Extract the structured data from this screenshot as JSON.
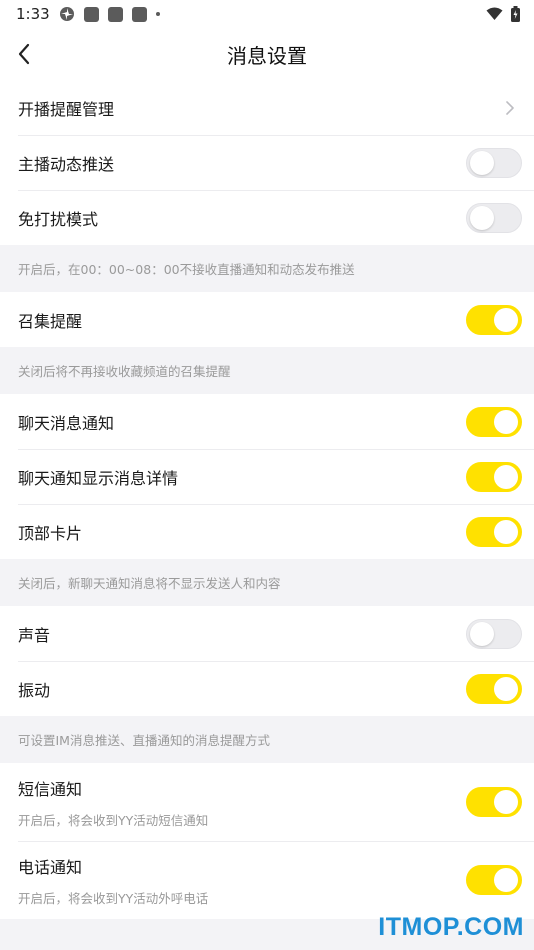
{
  "status_bar": {
    "time": "1:33"
  },
  "nav": {
    "title": "消息设置"
  },
  "groups": [
    {
      "rows": [
        {
          "label": "开播提醒管理"
        },
        {
          "label": "主播动态推送",
          "on": false
        },
        {
          "label": "免打扰模式",
          "on": false
        }
      ],
      "hint": "开启后，在00：00~08：00不接收直播通知和动态发布推送"
    },
    {
      "rows": [
        {
          "label": "召集提醒",
          "on": true
        }
      ],
      "hint": "关闭后将不再接收收藏频道的召集提醒"
    },
    {
      "rows": [
        {
          "label": "聊天消息通知",
          "on": true
        },
        {
          "label": "聊天通知显示消息详情",
          "on": true
        },
        {
          "label": "顶部卡片",
          "on": true
        }
      ],
      "hint": "关闭后，新聊天通知消息将不显示发送人和内容"
    },
    {
      "rows": [
        {
          "label": "声音",
          "on": false
        },
        {
          "label": "振动",
          "on": true
        }
      ],
      "hint": "可设置IM消息推送、直播通知的消息提醒方式"
    },
    {
      "rows": [
        {
          "label": "短信通知",
          "sub": "开启后，将会收到YY活动短信通知",
          "on": true
        },
        {
          "label": "电话通知",
          "sub": "开启后，将会收到YY活动外呼电话",
          "on": true
        }
      ]
    }
  ],
  "watermark": "ITMOP.COM",
  "colors": {
    "toggle_on": "#ffe100",
    "toggle_off": "#ececef",
    "watermark": "#1e8fd6"
  }
}
